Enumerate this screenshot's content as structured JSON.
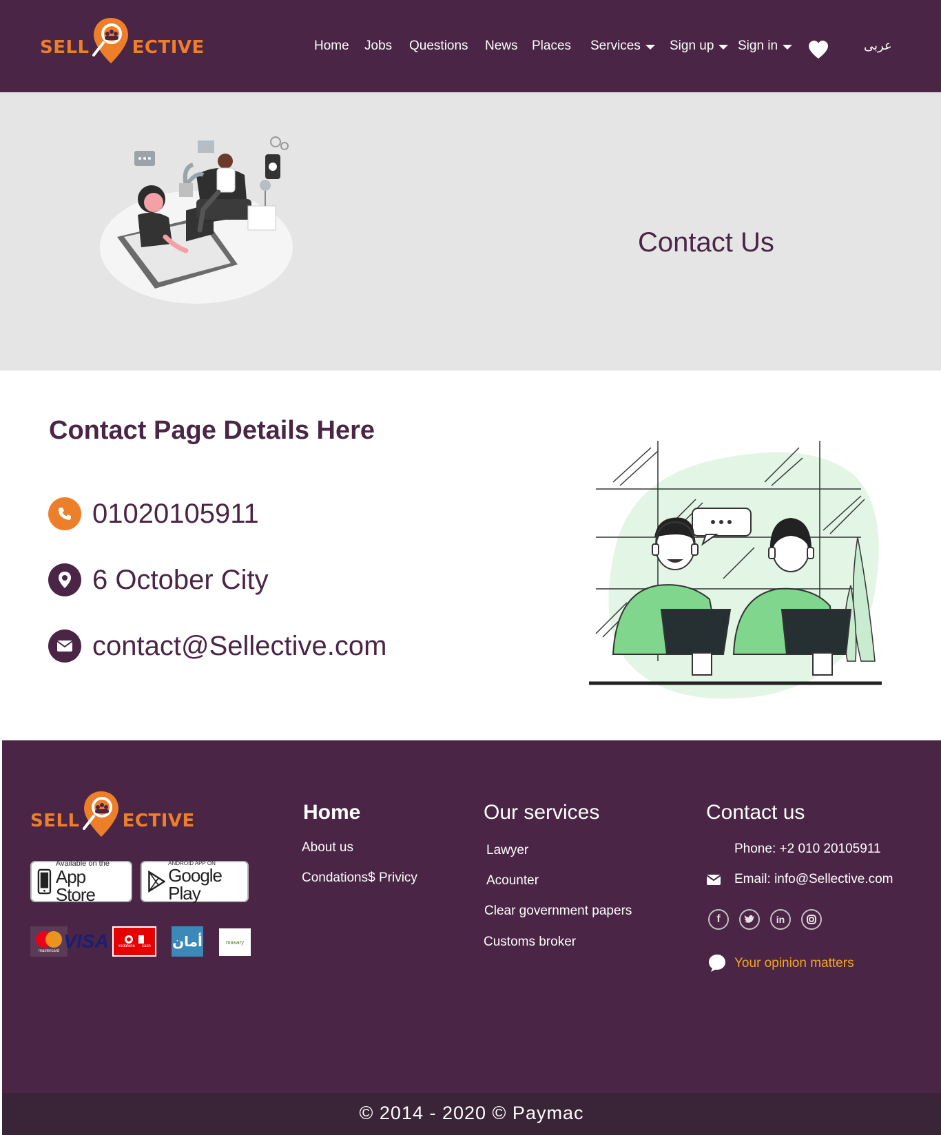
{
  "brand": {
    "left": "SELL",
    "right": "ECTIVE",
    "accent": "#ee7f2a",
    "primary": "#4a2545"
  },
  "nav": [
    {
      "label": "Home"
    },
    {
      "label": "Jobs"
    },
    {
      "label": "Questions"
    },
    {
      "label": "News"
    },
    {
      "label": "Places"
    },
    {
      "label": "Services",
      "dropdown": true
    },
    {
      "label": "Sign up",
      "dropdown": true
    },
    {
      "label": "Sign in",
      "dropdown": true
    }
  ],
  "nav_icons": {
    "favorites": "heart-icon"
  },
  "language": "عربى",
  "hero": {
    "title": "Contact Us"
  },
  "details": {
    "title": "Contact Page Details Here",
    "phone": "01020105911",
    "address": "6 October City",
    "email": "contact@Sellective.com"
  },
  "footer": {
    "stores": {
      "apple_small": "Available on the",
      "apple_big": "App Store",
      "google_small": "ANDROID APP ON",
      "google_big": "Google Play"
    },
    "payments": {
      "mastercard": "mastercard",
      "visa": "VISA",
      "vodafone": "vodafone",
      "vodafone_cash": "cash",
      "aman": "أمان",
      "masary": "masary"
    },
    "home": {
      "heading": "Home",
      "links": [
        "About us",
        "Condations$ Privicy"
      ]
    },
    "services": {
      "heading": "Our services",
      "links": [
        "Lawyer",
        "Acounter",
        "Clear government papers",
        "Customs broker"
      ]
    },
    "contact": {
      "heading": "Contact us",
      "phone": "Phone: +2 010 20105911",
      "email": "Email: info@Sellective.com",
      "opinion": "Your opinion matters"
    },
    "social": [
      "facebook-icon",
      "twitter-icon",
      "linkedin-icon",
      "instagram-icon"
    ],
    "copyright": "© 2014 - 2020 © Paymac"
  }
}
